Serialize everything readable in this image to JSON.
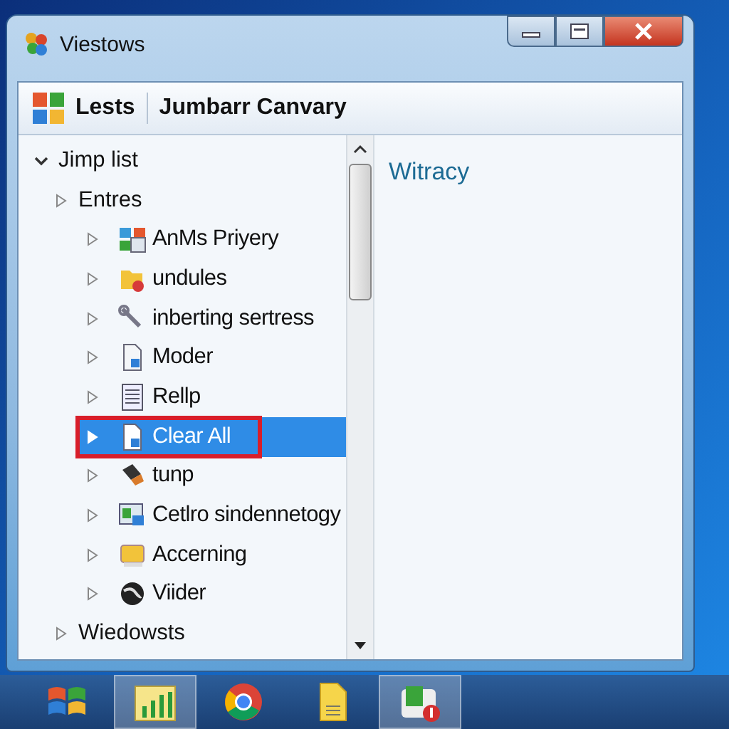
{
  "window": {
    "title": "Viestows"
  },
  "toolbar": {
    "label": "Lests",
    "title": "Jumbarr Canvary"
  },
  "tree": [
    {
      "label": "Jimp list",
      "expanded": true,
      "children": [
        {
          "label": "Entres",
          "expanded": false,
          "children": [
            {
              "label": "AnMs Priyery",
              "selected": false
            },
            {
              "label": "undules",
              "selected": false
            },
            {
              "label": "inberting sertress",
              "selected": false
            },
            {
              "label": "Moder",
              "selected": false
            },
            {
              "label": "Rellp",
              "selected": false
            },
            {
              "label": "Clear All",
              "selected": true
            },
            {
              "label": "tunp",
              "selected": false
            },
            {
              "label": "Cetlro sindennetogy",
              "selected": false
            },
            {
              "label": "Accerning",
              "selected": false
            },
            {
              "label": "Viider",
              "selected": false
            }
          ]
        },
        {
          "label": "Wiedowsts",
          "expanded": false
        }
      ]
    }
  ],
  "pane": {
    "heading": "Witracy"
  },
  "taskbar": [
    {
      "active": false
    },
    {
      "active": true
    },
    {
      "active": false
    },
    {
      "active": false
    },
    {
      "active": true
    }
  ]
}
